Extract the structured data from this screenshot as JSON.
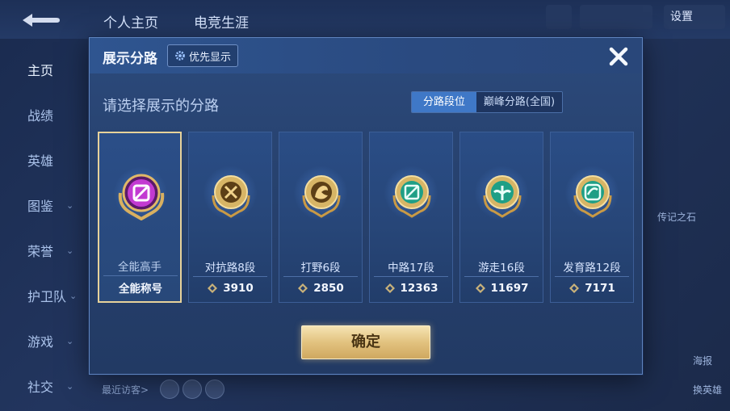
{
  "top_nav": {
    "tabs": [
      "个人主页",
      "电竞生涯"
    ],
    "settings_label": "设置"
  },
  "sidebar": {
    "items": [
      {
        "label": "主页",
        "chevron": false,
        "active": true
      },
      {
        "label": "战绩",
        "chevron": false
      },
      {
        "label": "英雄",
        "chevron": false
      },
      {
        "label": "图鉴",
        "chevron": true
      },
      {
        "label": "荣誉",
        "chevron": true
      },
      {
        "label": "护卫队",
        "chevron": true
      },
      {
        "label": "游戏",
        "chevron": true
      },
      {
        "label": "社交",
        "chevron": true
      }
    ]
  },
  "bottom": {
    "recent_visitors": "最近访客>",
    "right_labels": [
      "海报",
      "换英雄"
    ],
    "side_text": "传记之石"
  },
  "dialog": {
    "title": "展示分路",
    "priority_button": "优先显示",
    "subtitle": "请选择展示的分路",
    "segment": {
      "options": [
        "分路段位",
        "巅峰分路(全国)"
      ],
      "selected": "分路段位"
    },
    "confirm": "确定",
    "cards": [
      {
        "role": "全能高手",
        "value": "全能称号",
        "selected": true,
        "badge": "all-round-icon",
        "color": "#d03ad8"
      },
      {
        "role": "对抗路8段",
        "value": "3910",
        "selected": false,
        "badge": "clash-lane-icon",
        "color": "#c9a24e"
      },
      {
        "role": "打野6段",
        "value": "2850",
        "selected": false,
        "badge": "jungle-icon",
        "color": "#c9a24e"
      },
      {
        "role": "中路17段",
        "value": "12363",
        "selected": false,
        "badge": "mid-lane-icon",
        "color": "#2ec7a6"
      },
      {
        "role": "游走16段",
        "value": "11697",
        "selected": false,
        "badge": "roam-icon",
        "color": "#2ec7a6"
      },
      {
        "role": "发育路12段",
        "value": "7171",
        "selected": false,
        "badge": "farm-lane-icon",
        "color": "#2ec7a6"
      }
    ]
  },
  "colors": {
    "accent_gold": "#e2c27f",
    "segment_active": "#3f78c7",
    "panel": "#27426f"
  }
}
